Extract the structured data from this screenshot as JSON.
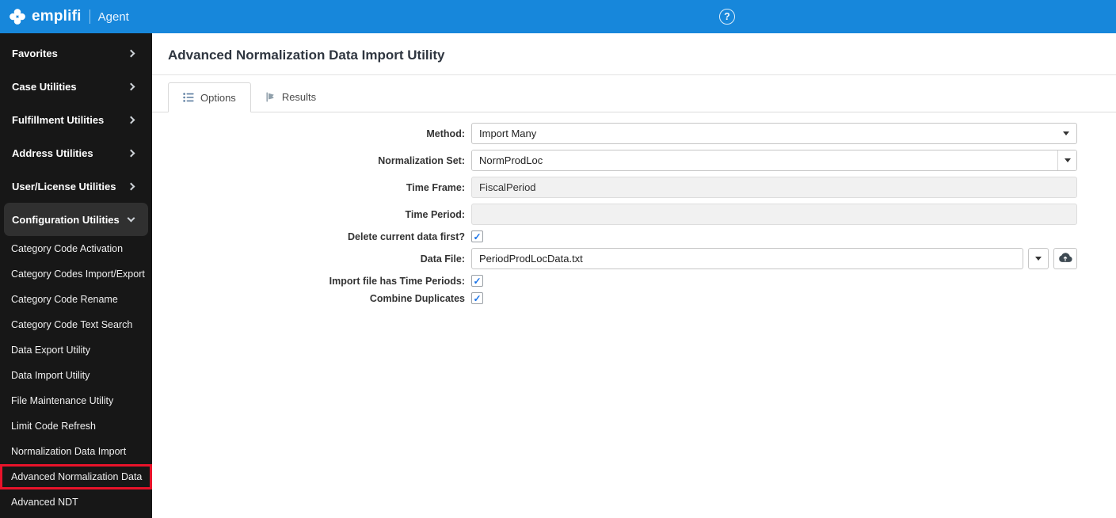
{
  "colors": {
    "topbar-blue": "#1787db",
    "sidebar-bg": "#171717",
    "active-item-bg": "#303030",
    "highlight-red": "#e8132a",
    "check-blue": "#1a73e8"
  },
  "topbar": {
    "brand": "emplifi",
    "app": "Agent",
    "help_glyph": "?"
  },
  "sidebar": {
    "items": [
      {
        "label": "Favorites",
        "expanded": false
      },
      {
        "label": "Case Utilities",
        "expanded": false
      },
      {
        "label": "Fulfillment Utilities",
        "expanded": false
      },
      {
        "label": "Address Utilities",
        "expanded": false
      },
      {
        "label": "User/License Utilities",
        "expanded": false
      },
      {
        "label": "Configuration Utilities",
        "expanded": true
      }
    ],
    "subitems": [
      {
        "label": "Category Code Activation",
        "highlighted": false
      },
      {
        "label": "Category Codes Import/Export",
        "highlighted": false
      },
      {
        "label": "Category Code Rename",
        "highlighted": false
      },
      {
        "label": "Category Code Text Search",
        "highlighted": false
      },
      {
        "label": "Data Export Utility",
        "highlighted": false
      },
      {
        "label": "Data Import Utility",
        "highlighted": false
      },
      {
        "label": "File Maintenance Utility",
        "highlighted": false
      },
      {
        "label": "Limit Code Refresh",
        "highlighted": false
      },
      {
        "label": "Normalization Data Import",
        "highlighted": false
      },
      {
        "label": "Advanced Normalization Data",
        "highlighted": true
      },
      {
        "label": "Advanced NDT",
        "highlighted": false
      }
    ]
  },
  "main": {
    "title": "Advanced Normalization Data Import Utility",
    "tabs": [
      {
        "label": "Options",
        "active": true
      },
      {
        "label": "Results",
        "active": false
      }
    ],
    "form": {
      "method": {
        "label": "Method:",
        "value": "Import Many"
      },
      "normalization_set": {
        "label": "Normalization Set:",
        "value": "NormProdLoc"
      },
      "time_frame": {
        "label": "Time Frame:",
        "value": "FiscalPeriod"
      },
      "time_period": {
        "label": "Time Period:",
        "value": ""
      },
      "delete_current": {
        "label": "Delete current data first?",
        "checked": true
      },
      "data_file": {
        "label": "Data File:",
        "value": "PeriodProdLocData.txt"
      },
      "import_has_time_periods": {
        "label": "Import file has Time Periods:",
        "checked": true
      },
      "combine_duplicates": {
        "label": "Combine Duplicates",
        "checked": true
      }
    }
  }
}
